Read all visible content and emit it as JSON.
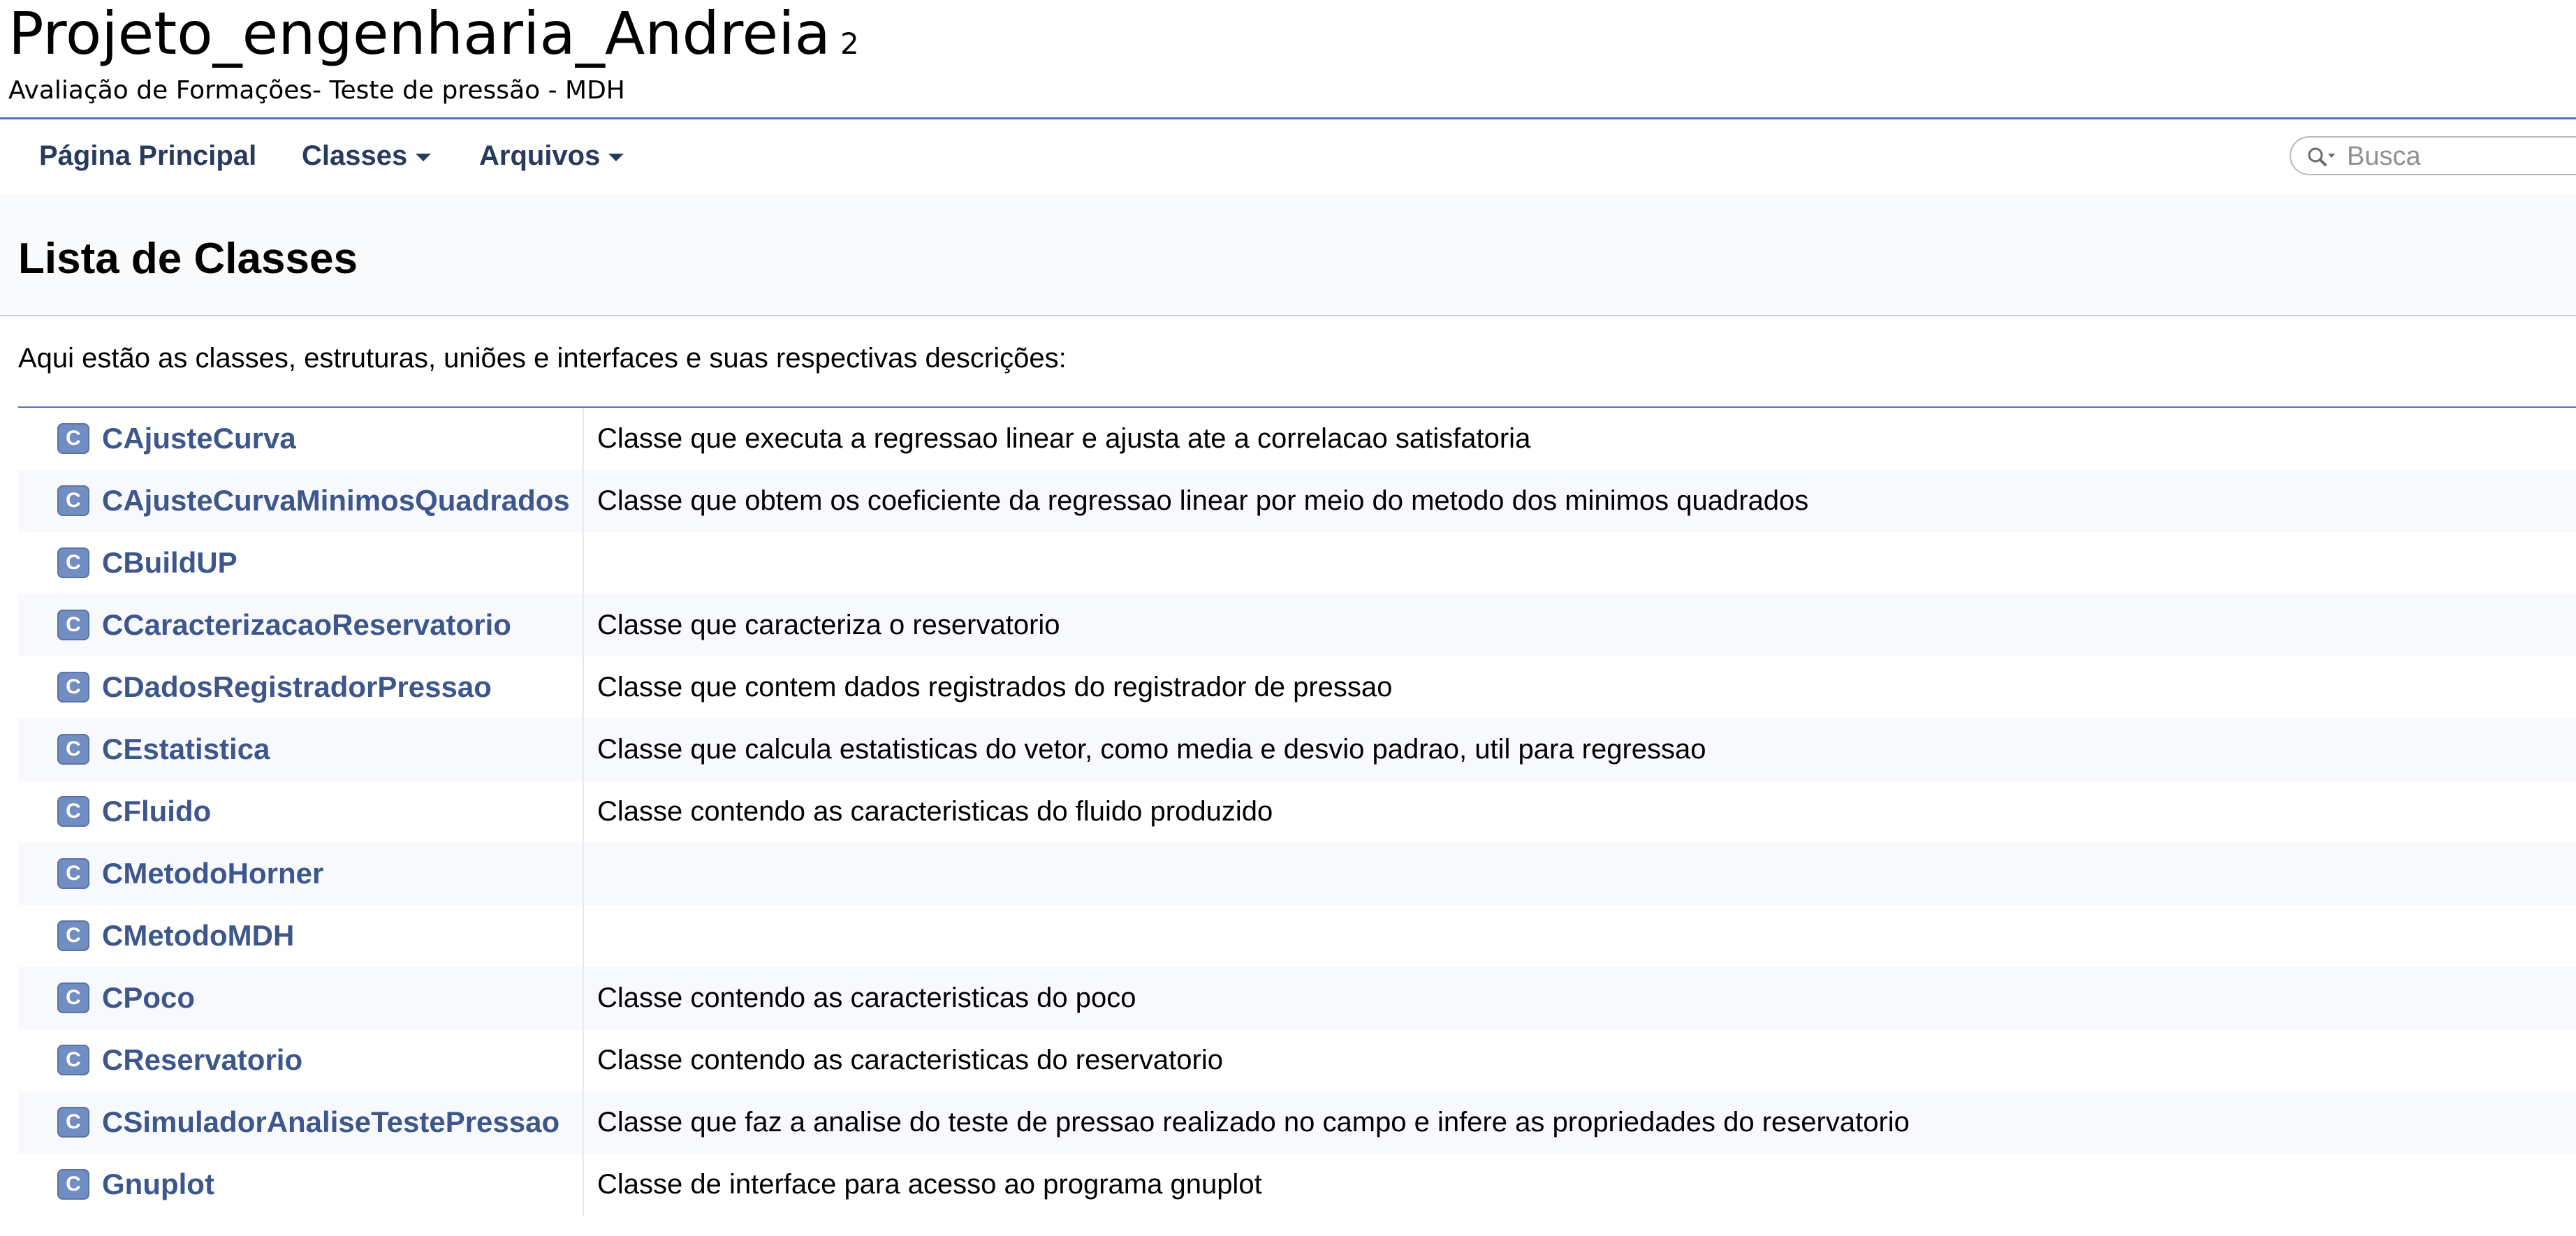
{
  "project": {
    "name": "Projeto_engenharia_Andreia",
    "number": "2",
    "brief": "Avaliação de Formações- Teste de pressão - MDH"
  },
  "navbar": {
    "items": [
      {
        "label": "Página Principal",
        "dropdown": false
      },
      {
        "label": "Classes",
        "dropdown": true
      },
      {
        "label": "Arquivos",
        "dropdown": true
      }
    ],
    "search": {
      "placeholder": "Busca",
      "icon": "search-icon"
    }
  },
  "page": {
    "title": "Lista de Classes",
    "intro": "Aqui estão as classes, estruturas, uniões e interfaces e suas respectivas descrições:"
  },
  "classes": [
    {
      "icon": "C",
      "name": "CAjusteCurva",
      "desc": "Classe que executa a regressao linear e ajusta ate a correlacao satisfatoria"
    },
    {
      "icon": "C",
      "name": "CAjusteCurvaMinimosQuadrados",
      "desc": "Classe que obtem os coeficiente da regressao linear por meio do metodo dos minimos quadrados"
    },
    {
      "icon": "C",
      "name": "CBuildUP",
      "desc": ""
    },
    {
      "icon": "C",
      "name": "CCaracterizacaoReservatorio",
      "desc": "Classe que caracteriza o reservatorio"
    },
    {
      "icon": "C",
      "name": "CDadosRegistradorPressao",
      "desc": "Classe que contem dados registrados do registrador de pressao"
    },
    {
      "icon": "C",
      "name": "CEstatistica",
      "desc": "Classe que calcula estatisticas do vetor, como media e desvio padrao, util para regressao"
    },
    {
      "icon": "C",
      "name": "CFluido",
      "desc": "Classe contendo as caracteristicas do fluido produzido"
    },
    {
      "icon": "C",
      "name": "CMetodoHorner",
      "desc": ""
    },
    {
      "icon": "C",
      "name": "CMetodoMDH",
      "desc": ""
    },
    {
      "icon": "C",
      "name": "CPoco",
      "desc": "Classe contendo as caracteristicas do poco"
    },
    {
      "icon": "C",
      "name": "CReservatorio",
      "desc": "Classe contendo as caracteristicas do reservatorio"
    },
    {
      "icon": "C",
      "name": "CSimuladorAnaliseTestePressao",
      "desc": "Classe que faz a analise do teste de pressao realizado no campo e infere as propriedades do reservatorio"
    },
    {
      "icon": "C",
      "name": "Gnuplot",
      "desc": "Classe de interface para acesso ao programa gnuplot"
    }
  ],
  "colors": {
    "link": "#3d578c",
    "nav_text": "#283a5d",
    "icon_bg": "#728dc1",
    "rule": "#5373b4",
    "row_alt": "#f8f9fc"
  }
}
